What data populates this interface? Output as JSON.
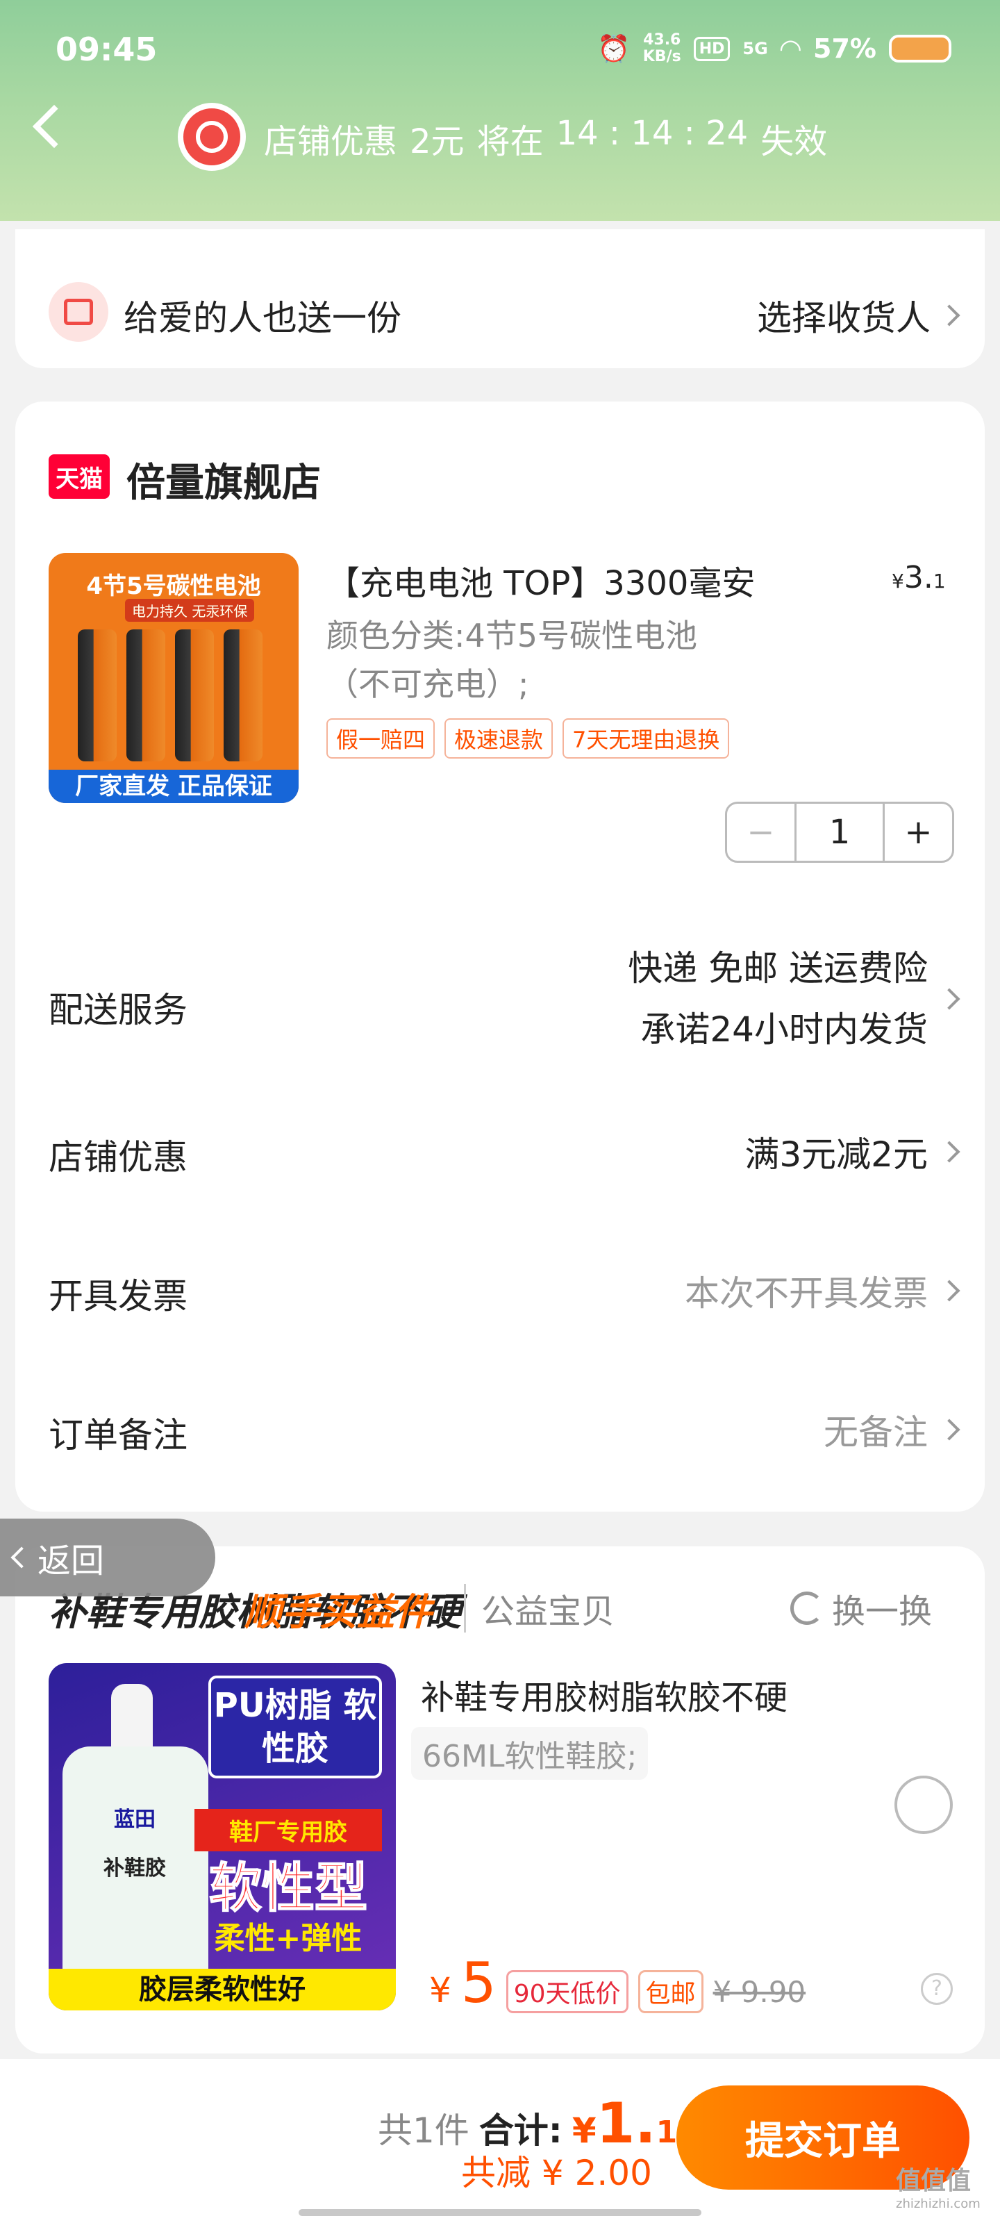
{
  "status_bar": {
    "time": "09:45",
    "net_speed_value": "43.6",
    "net_speed_unit": "KB/s",
    "hd": "HD",
    "network": "5G",
    "battery": "57%"
  },
  "header": {
    "promo_label": "店铺优惠",
    "promo_amount": "2元",
    "promo_will": "将在",
    "countdown": "14 : 14 : 24",
    "promo_expire": "失效"
  },
  "gift": {
    "label": "给爱的人也送一份",
    "action": "选择收货人"
  },
  "shop": {
    "badge": "天猫",
    "name": "倍量旗舰店"
  },
  "product": {
    "image_top": "4节5号碳性电池",
    "image_sub": "电力持久 无汞环保",
    "image_bottom": "厂家直发 正品保证",
    "title": "【充电电池 TOP】3300毫安",
    "price_symbol": "¥",
    "price_int": "3.",
    "price_dec": "1",
    "spec_line1": "颜色分类:4节5号碳性电池",
    "spec_line2": "（不可充电）;",
    "tags": [
      "假一赔四",
      "极速退款",
      "7天无理由退换"
    ],
    "quantity": "1",
    "minus": "−",
    "plus": "+"
  },
  "rows": {
    "shipping_label": "配送服务",
    "shipping_line1": "快递 免邮 送运费险",
    "shipping_line2": "承诺24小时内发货",
    "discount_label": "店铺优惠",
    "discount_value": "满3元减2元",
    "invoice_label": "开具发票",
    "invoice_value": "本次不开具发票",
    "remark_label": "订单备注",
    "remark_value": "无备注"
  },
  "back_pill": {
    "label": "返回"
  },
  "extra": {
    "title": "补鞋专用胶树脂软胶不硬",
    "subtitle": "顺手买益件",
    "charity": "公益宝贝",
    "refresh": "换一换",
    "image_badge": "PU树脂 软性胶",
    "image_red": "鞋厂专用胶",
    "image_big": "软性型",
    "image_yellow": "柔性+弹性",
    "image_footer": "胶层柔软性好",
    "image_brand": "蓝田",
    "image_brand2": "补鞋胶",
    "spec": "66ML软性鞋胶;",
    "price_symbol": "¥",
    "price": "5",
    "tag_low": "90天低价",
    "tag_free": "包邮",
    "original_price": "¥ 9.90",
    "help": "?"
  },
  "footer": {
    "count": "共1件",
    "total_label": "合计:",
    "total_symbol": "¥",
    "total_int": "1.",
    "total_dec": "10",
    "discount": "共减 ¥ 2.00",
    "submit": "提交订单",
    "watermark": "值值值",
    "watermark_url": "zhizhizhi.com"
  }
}
